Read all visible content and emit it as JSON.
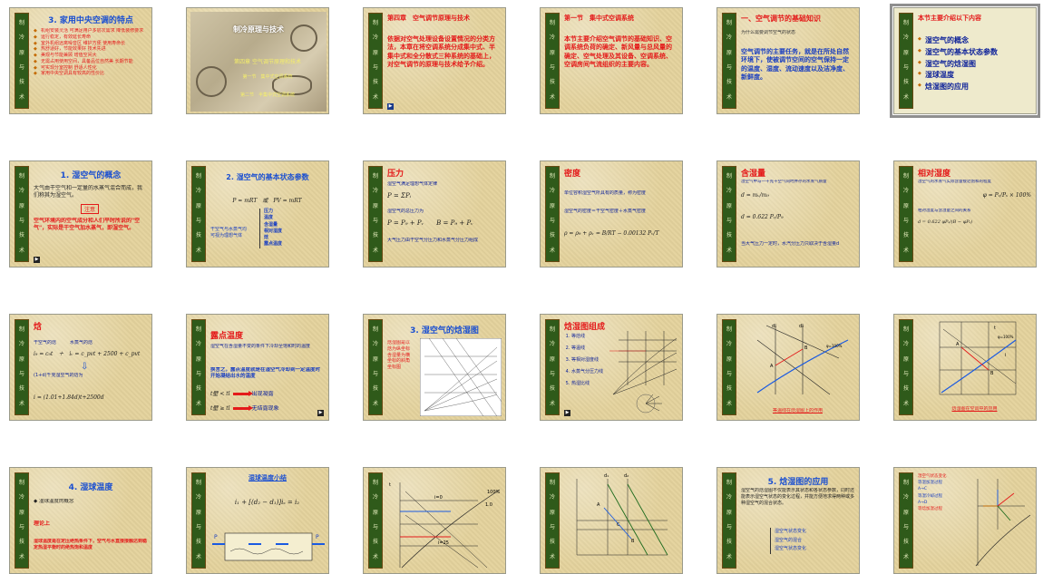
{
  "strip_chars": [
    "制",
    "冷",
    "原",
    "与",
    "技",
    "术"
  ],
  "slides": [
    {
      "title": "3. 家用中央空调的特点",
      "bullets": [
        "机组安装灵活 可满足用户多层次需求 降低装修要求",
        "运行稳定，有效延长寿命",
        "室外机组远离噪音区 维护方便 使用寿命长",
        "热舒适好，节能效果好 技术先进",
        "美观与节能兼顾 增值空间大",
        "无需占用使用空间，具备品位自然美 长期节能",
        "可实现分室控制 舒适人性化",
        "家用中央空调具有较高的性价比"
      ]
    },
    {
      "photo_title": "制冷原理与技术",
      "photo_sub": "第四章 空气调节原理和技术",
      "photo_l1": "第一节　集中式空调系统",
      "photo_l2": "第二节　半集中式空调系统"
    },
    {
      "title": "第四章　空气调节原理与技术",
      "body": "依据对空气处理设备设置情况的分类方法，本章在将空调系统分成集中式、半集中式和全分散式三种系统的基础上，对空气调节的原理与技术给予介绍。"
    },
    {
      "title": "第一节　集中式空调系统",
      "body": "本节主要介绍空气调节的基础知识、空调系统负荷的确定、新风量与总风量的确定、空气处理及其设备、空调系统、空调房间气流组织的主要内容。"
    },
    {
      "title": "一、空气调节的基础知识",
      "note": "为什么需要调节空气的状态",
      "body": "空气调节的主要任务，就是在所处自然环境下，使被调节空间的空气保持一定的温度、湿度、流动速度以及洁净度、新鲜度。"
    },
    {
      "title": "本节主要介绍以下内容",
      "items": [
        "湿空气的概念",
        "湿空气的基本状态参数",
        "湿空气的焓湿图",
        "湿球温度",
        "焓湿图的应用"
      ]
    },
    {
      "title": "1. 湿空气的概念",
      "body": "大气由干空气和一定量的水蒸气混合而成，我们称其为湿空气。",
      "box": "注意",
      "red": "空气环境内的空气成分和人们平时所说的\"空气\"，实际是干空气加水蒸气，即湿空气。"
    },
    {
      "title": "2. 湿空气的基本状态参数",
      "eq1": "P = mRT　或　PV = mRT",
      "left": "干空气与水蒸气均可视为理想气体",
      "params": [
        "压力",
        "温度",
        "含湿量",
        "相对湿度",
        "焓",
        "露点温度"
      ]
    },
    {
      "title": "压力",
      "line1": "湿空气满足理想气体定律",
      "line2": "湿空气的总压力为",
      "line3": "大气压力由干空气分压力和水蒸气分压力组成"
    },
    {
      "title": "密度",
      "line1": "单位容积湿空气所具有的质量，称为密度",
      "line2": "湿空气的密度＝干空气密度＋水蒸气密度"
    },
    {
      "title": "含湿量",
      "line1": "湿空气中与一千克干空气同时并存的水蒸气质量",
      "line2": "当大气压力一定时，水汽分压力只取决于含湿量d"
    },
    {
      "title": "相对湿度",
      "line1": "湿空气的水蒸气实际含量接近饱和的程度",
      "line2": "相对湿度与含湿量之间的关系"
    },
    {
      "title": "焓",
      "line1": "干空气的焓",
      "line2": "水蒸气的焓",
      "line3": "(1+d)千克湿空气的焓为",
      "line4": "i = (1.01+1.84d)t+2500d"
    },
    {
      "title": "露点温度",
      "line1": "湿空气在含湿量不变的条件下冷却至饱和时的温度",
      "line2": "换言之，露点温度就是在湿空气冷却到一定温度时开始凝结出水的温度",
      "row1": "t壁 < tl",
      "res1": "出现凝露",
      "row2": "t壁 ≥ tl",
      "res2": "无结露现象"
    },
    {
      "title": "3. 湿空气的焓湿图",
      "side": "焓湿图是以焓为纵坐标含湿量为横坐标的斜角坐标图"
    },
    {
      "title": "焓湿图组成",
      "items": [
        "等焓线",
        "等温线",
        "等相对湿度线",
        "水蒸气分压力线",
        "热湿比线"
      ]
    },
    {
      "title": "",
      "caption": "等温线在焓湿图上的作用",
      "labels": [
        "d₁",
        "d₂",
        "A",
        "B",
        "φ=100%"
      ]
    },
    {
      "title": "",
      "caption": "焓湿图在空调中的应用",
      "labels": [
        "t",
        "i",
        "A",
        "B",
        "φ=100%"
      ]
    },
    {
      "title": "4. 湿球温度",
      "line1": "湿球温度的概念",
      "line2": "理论上",
      "line3": "湿球温度是在定压绝热条件下，空气与水直接接触达到稳定热湿平衡时的绝热饱和温度"
    },
    {
      "title": "湿球温度小结",
      "eq": "i₁ + [(d₂ − d₁)]iₛ = i₂",
      "p_label": "P"
    },
    {
      "title": "",
      "labels": [
        "t",
        "i=0",
        "1.0",
        "100%",
        "i=25"
      ]
    },
    {
      "title": "",
      "labels": [
        "d₁",
        "d₂",
        "A",
        "B",
        "C"
      ]
    },
    {
      "title": "5. 焓湿图的应用",
      "body": "湿空气的焓湿图不仅能表示其状态和各状态参数，同时还能表示湿空气状态的变化过程，并能方便地求得两种或多种湿空气的混合状态。",
      "items": [
        "湿空气状态变化",
        "湿空气的混合",
        "湿空气状态变化"
      ]
    },
    {
      "title": "",
      "items": [
        "湿空气状态变化",
        "等温加湿过程",
        "A→C",
        "等湿冷却过程",
        "A→D",
        "等焓加湿过程"
      ]
    }
  ]
}
